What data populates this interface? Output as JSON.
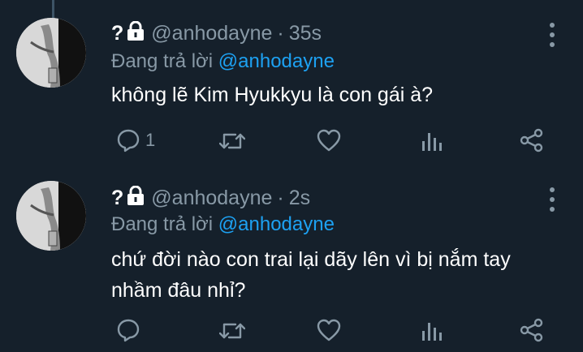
{
  "colors": {
    "background": "#15202b",
    "secondary_text": "#8899a6",
    "link": "#1da1f2",
    "thread_line": "#3d5466"
  },
  "tweets": [
    {
      "display_name": "?",
      "lock_icon": "lock-icon",
      "handle": "@anhodayne",
      "separator": "·",
      "time": "35s",
      "reply_label": "Đang trả lời",
      "reply_to": "@anhodayne",
      "text": "không lẽ Kim Hyukkyu là con gái à?",
      "reply_count": "1"
    },
    {
      "display_name": "?",
      "lock_icon": "lock-icon",
      "handle": "@anhodayne",
      "separator": "·",
      "time": "2s",
      "reply_label": "Đang trả lời",
      "reply_to": "@anhodayne",
      "text_line1": "chứ đời nào con trai lại dãy lên vì bị nắm tay",
      "text_line2": "nhầm đâu nhỉ?",
      "reply_count": ""
    }
  ],
  "icons": {
    "reply": "reply-icon",
    "retweet": "retweet-icon",
    "like": "heart-icon",
    "analytics": "analytics-icon",
    "share": "share-icon",
    "more": "more-vertical-icon"
  }
}
